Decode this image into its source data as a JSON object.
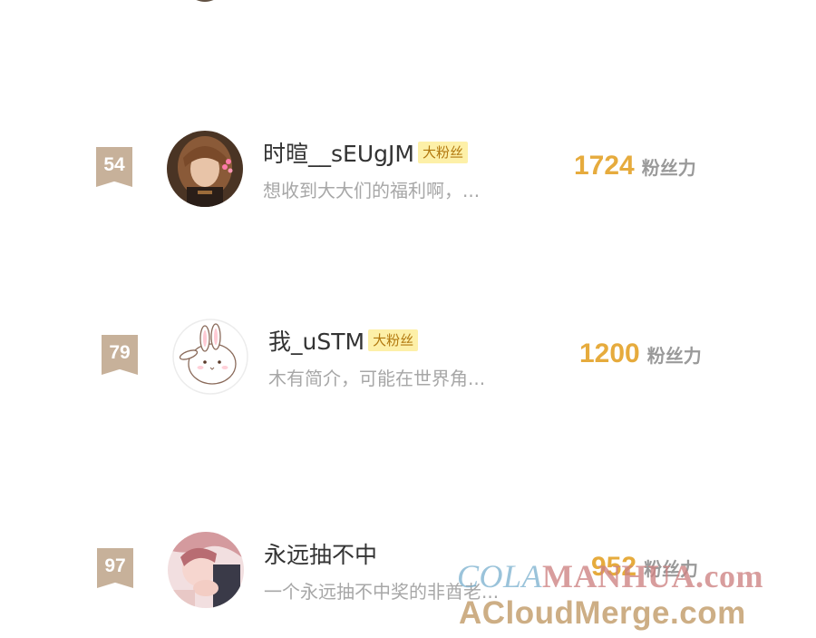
{
  "rows": [
    {
      "rank": "54",
      "username": "时暄__sEUgJM",
      "badge": "大粉丝",
      "bio": "想收到大大们的福利啊，...",
      "power": "1724",
      "power_label": "粉丝力"
    },
    {
      "rank": "79",
      "username": "我_uSTM",
      "badge": "大粉丝",
      "bio": "木有简介，可能在世界角...",
      "power": "1200",
      "power_label": "粉丝力"
    },
    {
      "rank": "97",
      "username": "永远抽不中",
      "badge": "",
      "bio": "一个永远抽不中奖的非酋老...",
      "power": "952",
      "power_label": "粉丝力"
    }
  ],
  "watermark": {
    "line1_prefix": "COLA",
    "line1_suffix": "MANHUA.com",
    "line2": "ACloudMerge.com"
  },
  "colors": {
    "rank_badge": "#c7b19a",
    "power_value": "#e6ab3d",
    "fan_badge_bg": "#fdf0a8",
    "fan_badge_text": "#b2780e"
  }
}
